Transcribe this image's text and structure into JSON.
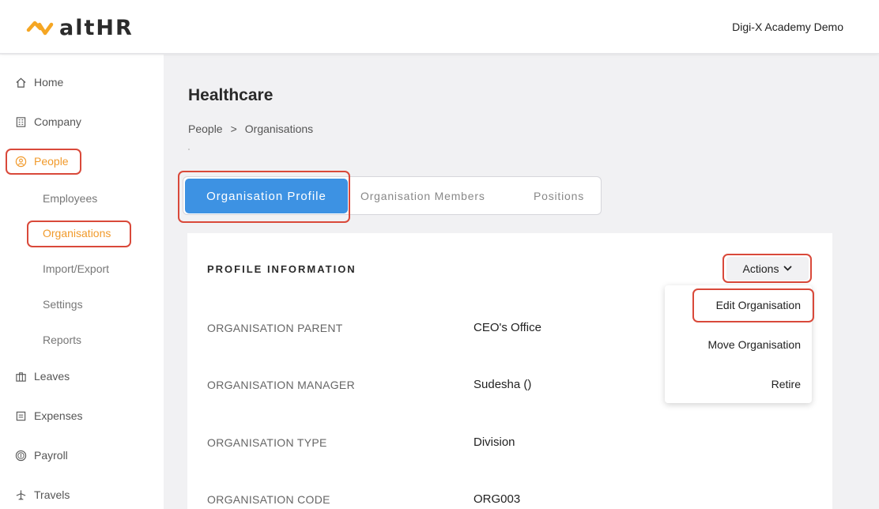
{
  "brand": {
    "logo_text": "altHR",
    "logo_color": "#f5a623"
  },
  "header": {
    "company_name": "Digi-X Academy Demo"
  },
  "sidebar": {
    "items": [
      {
        "label": "Home",
        "icon": "home-icon"
      },
      {
        "label": "Company",
        "icon": "building-icon"
      },
      {
        "label": "People",
        "icon": "person-circle-icon"
      },
      {
        "label": "Leaves",
        "icon": "briefcase-icon"
      },
      {
        "label": "Expenses",
        "icon": "receipt-icon"
      },
      {
        "label": "Payroll",
        "icon": "dollar-circle-icon"
      },
      {
        "label": "Travels",
        "icon": "airplane-icon"
      }
    ],
    "people_sub": [
      "Employees",
      "Organisations",
      "Import/Export",
      "Settings",
      "Reports"
    ],
    "active_item": "People",
    "active_sub": "Organisations"
  },
  "page": {
    "title": "Healthcare",
    "breadcrumb": [
      "People",
      ">",
      "Organisations"
    ]
  },
  "tabs": [
    "Organisation Profile",
    "Organisation Members",
    "Positions"
  ],
  "profile": {
    "section_title": "PROFILE INFORMATION",
    "actions_label": "Actions",
    "rows": [
      {
        "label": "ORGANISATION PARENT",
        "value": "CEO's Office"
      },
      {
        "label": "ORGANISATION MANAGER",
        "value": "Sudesha ()"
      },
      {
        "label": "ORGANISATION TYPE",
        "value": "Division"
      },
      {
        "label": "ORGANISATION CODE",
        "value": "ORG003"
      }
    ]
  },
  "actions_menu": [
    "Edit Organisation",
    "Move Organisation",
    "Retire"
  ],
  "colors": {
    "accent": "#f19a2b",
    "tab_active": "#3d92e3",
    "highlight": "#d9493a"
  }
}
